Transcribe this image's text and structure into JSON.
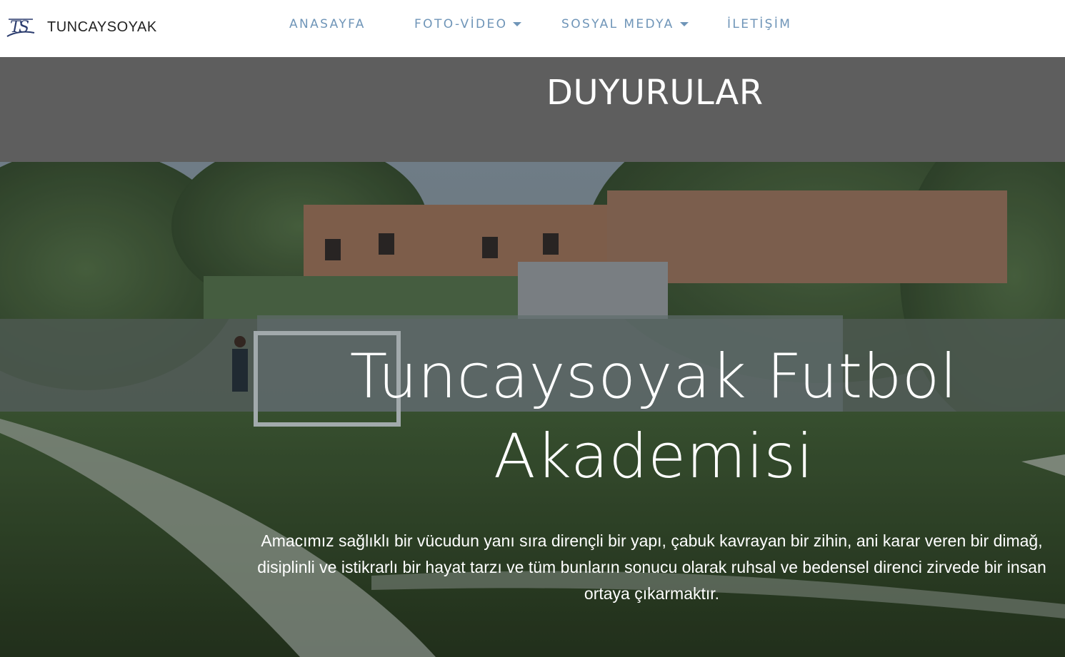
{
  "navbar": {
    "logo_text": "TS",
    "brand_name": "TUNCAYSOYAK",
    "items": [
      {
        "label": "ANASAYFA",
        "has_dropdown": false
      },
      {
        "label": "FOTO-VİDEO",
        "has_dropdown": true
      },
      {
        "label": "SOSYAL MEDYA",
        "has_dropdown": true
      },
      {
        "label": "İLETİŞİM",
        "has_dropdown": false
      }
    ]
  },
  "banner": {
    "title": "DUYURULAR"
  },
  "hero": {
    "title": "Tuncaysoyak Futbol Akademisi",
    "text": "Amacımız sağlıklı bir vücudun yanı sıra dirençli bir yapı, çabuk kavrayan bir zihin, ani karar veren bir dimağ, disiplinli ve istikrarlı bir hayat tarzı ve tüm bunların sonucu olarak ruhsal ve bedensel direnci zirvede bir insan ortaya çıkarmaktır."
  },
  "colors": {
    "nav_link": "#6f95b8",
    "banner_bg": "#5e5e5e",
    "hero_text": "#ffffff",
    "brand_text": "#222222"
  },
  "icons": [
    "ts-logo-icon",
    "chevron-down-icon"
  ]
}
